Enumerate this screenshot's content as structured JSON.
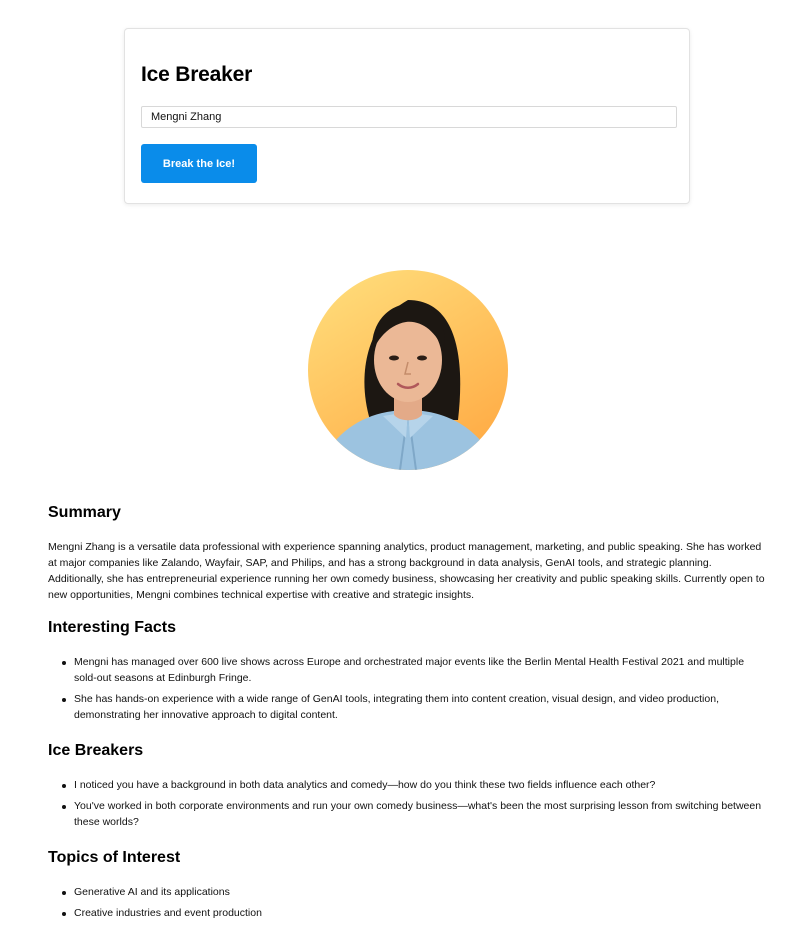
{
  "header": {
    "title": "Ice Breaker"
  },
  "search": {
    "value": "Mengni Zhang"
  },
  "button": {
    "label": "Break the Ice!"
  },
  "colors": {
    "button_bg": "#0a8cea",
    "avatar_bg_top": "#ffe080",
    "avatar_bg_bottom": "#ffb24a"
  },
  "summary": {
    "heading": "Summary",
    "text": "Mengni Zhang is a versatile data professional with experience spanning analytics, product management, marketing, and public speaking. She has worked at major companies like Zalando, Wayfair, SAP, and Philips, and has a strong background in data analysis, GenAI tools, and strategic planning. Additionally, she has entrepreneurial experience running her own comedy business, showcasing her creativity and public speaking skills. Currently open to new opportunities, Mengni combines technical expertise with creative and strategic insights."
  },
  "facts": {
    "heading": "Interesting Facts",
    "items": [
      "Mengni has managed over 600 live shows across Europe and orchestrated major events like the Berlin Mental Health Festival 2021 and multiple sold-out seasons at Edinburgh Fringe.",
      "She has hands-on experience with a wide range of GenAI tools, integrating them into content creation, visual design, and video production, demonstrating her innovative approach to digital content."
    ]
  },
  "icebreakers": {
    "heading": "Ice Breakers",
    "items": [
      "I noticed you have a background in both data analytics and comedy—how do you think these two fields influence each other?",
      "You've worked in both corporate environments and run your own comedy business—what's been the most surprising lesson from switching between these worlds?"
    ]
  },
  "topics": {
    "heading": "Topics of Interest",
    "items": [
      "Generative AI and its applications",
      "Creative industries and event production"
    ]
  }
}
